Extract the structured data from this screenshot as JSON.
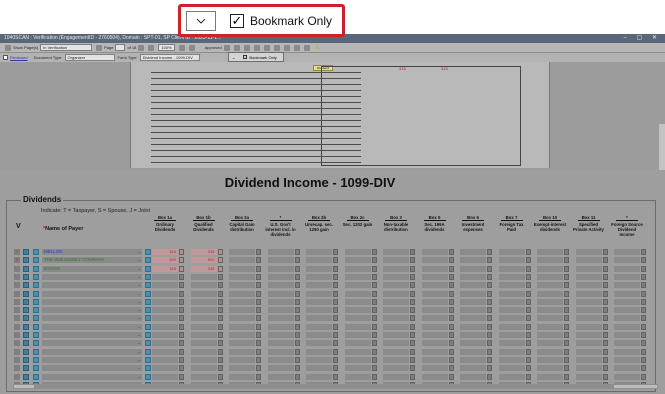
{
  "callout": {
    "bookmark_label": "Bookmark Only",
    "checked": true
  },
  "app": {
    "title": "1040SCAN : Verification (EngagementID - 2760504), Domain : SPT-01, SP Client ID : 2023-11-1...",
    "toolbar": {
      "show_pages_label": "Show Page(s)",
      "show_pages_value": "In Verification",
      "page_label": "Page",
      "page_total": "of 18",
      "zoom": "100%",
      "approved_label": "Approved"
    },
    "formbar": {
      "reviewed_label": "Reviewed",
      "doc_type_label": "Document Type",
      "doc_type_value": "Organizer",
      "form_type_label": "Form Type",
      "form_type_value": "Dividend Income - 1099-DIV"
    },
    "popup": {
      "bookmark_label": "Bookmark Only"
    },
    "scan": {
      "sticky_label": "Dividend",
      "red_mark_1": "315",
      "red_mark_2": "315"
    }
  },
  "form": {
    "title": "Dividend Income - 1099-DIV",
    "section": "Dividends",
    "indicate": "Indicate: T = Taxpayer, S = Spouse, J = Joint",
    "v_label": "V",
    "payer_header": "Name of Payer",
    "payer_star": "*",
    "columns": [
      {
        "box": "Box 1a",
        "label": "Ordinary Dividends"
      },
      {
        "box": "Box 1b",
        "label": "Qualified Dividends"
      },
      {
        "box": "Box 2a",
        "label": "Capital Gain distribution"
      },
      {
        "box": "*",
        "label": "U.S. Gov't interest incl. in dividends"
      },
      {
        "box": "Box 2b",
        "label": "Unrecap. sec. 1250 gain"
      },
      {
        "box": "Box 2c",
        "label": "Sec. 1202 gain"
      },
      {
        "box": "Box 3",
        "label": "Non-taxable distribution"
      },
      {
        "box": "Box 5",
        "label": "Sec. 199A dividends"
      },
      {
        "box": "Box 6",
        "label": "Investment expenses"
      },
      {
        "box": "Box 7",
        "label": "Foreign Tax Paid"
      },
      {
        "box": "Box 10",
        "label": "Exempt-interest dividends"
      },
      {
        "box": "Box 11",
        "label": "Specified Private Activity"
      },
      {
        "box": "*",
        "label": "Foreign Source Dividend Income"
      }
    ],
    "rows": [
      {
        "ind": "T",
        "payer": "MELLON",
        "color": "#2d3cc0",
        "box1a": "315",
        "box1b": "315"
      },
      {
        "ind": "S",
        "payer": "THE Walt DISNEY COMPANY",
        "color": "#2e7a22",
        "box1a": "600",
        "box1b": "600"
      },
      {
        "ind": "",
        "payer": "EXXON",
        "color": "#2e7a22",
        "box1a": "315",
        "box1b": "315"
      },
      {
        "ind": "",
        "payer": "",
        "box1a": "",
        "box1b": ""
      },
      {
        "ind": "",
        "payer": "",
        "box1a": "",
        "box1b": ""
      },
      {
        "ind": "",
        "payer": "",
        "box1a": "",
        "box1b": ""
      },
      {
        "ind": "",
        "payer": "",
        "box1a": "",
        "box1b": ""
      },
      {
        "ind": "",
        "payer": "",
        "box1a": "",
        "box1b": ""
      },
      {
        "ind": "",
        "payer": "",
        "box1a": "",
        "box1b": ""
      },
      {
        "ind": "",
        "payer": "",
        "box1a": "",
        "box1b": ""
      },
      {
        "ind": "",
        "payer": "",
        "box1a": "",
        "box1b": ""
      },
      {
        "ind": "",
        "payer": "",
        "box1a": "",
        "box1b": ""
      },
      {
        "ind": "",
        "payer": "",
        "box1a": "",
        "box1b": ""
      },
      {
        "ind": "",
        "payer": "",
        "box1a": "",
        "box1b": ""
      },
      {
        "ind": "",
        "payer": "",
        "box1a": "",
        "box1b": ""
      },
      {
        "ind": "",
        "payer": "",
        "box1a": "",
        "box1b": ""
      },
      {
        "ind": "",
        "payer": "",
        "box1a": "",
        "box1b": ""
      }
    ]
  }
}
